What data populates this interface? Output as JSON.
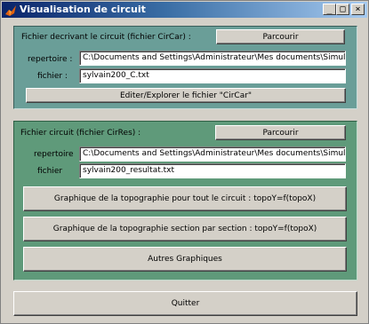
{
  "window": {
    "title": "Visualisation de circuit",
    "minimize": "_",
    "maximize": "□",
    "close": "×"
  },
  "panel1": {
    "heading": "Fichier decrivant le circuit (fichier CirCar) :",
    "browse_label": "Parcourir",
    "repertoire_label": "repertoire :",
    "repertoire_value": "C:\\Documents and Settings\\Administrateur\\Mes documents\\Simulateur\\Traitement",
    "fichier_label": "fichier :",
    "fichier_value": "sylvain200_C.txt",
    "edit_label": "Editer/Explorer le fichier \"CirCar\""
  },
  "panel2": {
    "heading": "Fichier circuit (fichier CirRes) :",
    "browse_label": "Parcourir",
    "repertoire_label": "repertoire",
    "repertoire_value": "C:\\Documents and Settings\\Administrateur\\Mes documents\\Simulateur\\Traitement",
    "fichier_label": "fichier",
    "fichier_value": "sylvain200_resultat.txt",
    "graph1_label": "Graphique de la topographie pour tout le circuit : topoY=f(topoX)",
    "graph2_label": "Graphique de la topographie section par section : topoY=f(topoX)",
    "graph3_label": "Autres Graphiques"
  },
  "quit_label": "Quitter"
}
